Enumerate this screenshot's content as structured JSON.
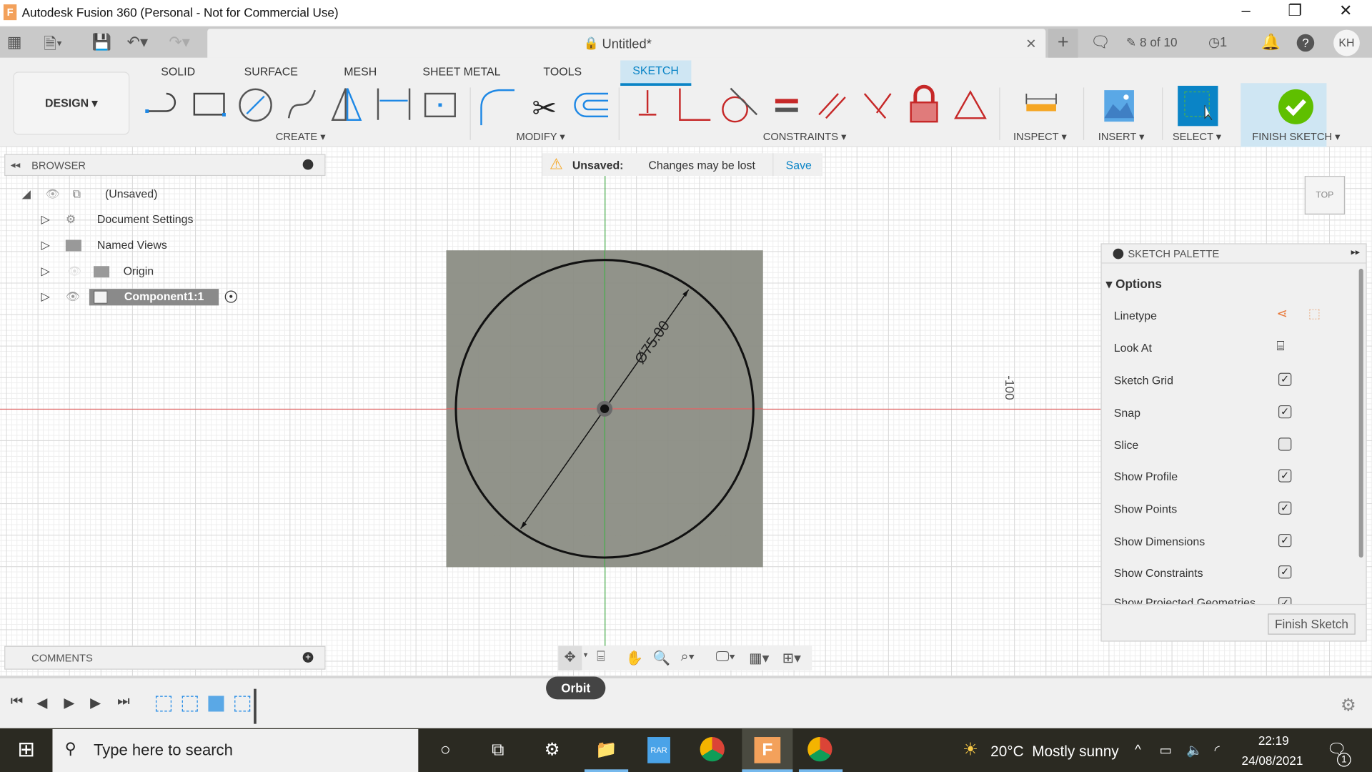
{
  "window": {
    "title": "Autodesk Fusion 360 (Personal - Not for Commercial Use)",
    "app_logo": "F",
    "minimize": "–",
    "restore": "❐",
    "close": "✕"
  },
  "quickbar": {
    "doc_title": "Untitled*",
    "close_tab": "✕",
    "new_tab": "+",
    "jobs": "8 of 10",
    "history_count": "1",
    "user_initials": "KH"
  },
  "ribbon": {
    "workspace": "DESIGN ▾",
    "tabs": [
      "SOLID",
      "SURFACE",
      "MESH",
      "SHEET METAL",
      "TOOLS",
      "SKETCH"
    ],
    "active_tab": "SKETCH",
    "groups": {
      "create": "CREATE ▾",
      "modify": "MODIFY ▾",
      "constraints": "CONSTRAINTS ▾",
      "inspect": "INSPECT ▾",
      "insert": "INSERT ▾",
      "select": "SELECT ▾",
      "finish": "FINISH SKETCH ▾"
    }
  },
  "browser": {
    "title": "BROWSER",
    "items": [
      {
        "label": "(Unsaved)"
      },
      {
        "label": "Document Settings"
      },
      {
        "label": "Named Views"
      },
      {
        "label": "Origin"
      },
      {
        "label": "Component1:1"
      }
    ]
  },
  "unsaved_bar": {
    "label": "Unsaved:",
    "message": "Changes may be lost",
    "save": "Save"
  },
  "viewcube": {
    "face": "TOP"
  },
  "sketch": {
    "dimension": "Ø75.00",
    "ruler_label": "-100"
  },
  "palette": {
    "title": "SKETCH PALETTE",
    "section": "Options",
    "rows": [
      {
        "label": "Linetype"
      },
      {
        "label": "Look At"
      },
      {
        "label": "Sketch Grid",
        "checked": true
      },
      {
        "label": "Snap",
        "checked": true
      },
      {
        "label": "Slice",
        "checked": false
      },
      {
        "label": "Show Profile",
        "checked": true
      },
      {
        "label": "Show Points",
        "checked": true
      },
      {
        "label": "Show Dimensions",
        "checked": true
      },
      {
        "label": "Show Constraints",
        "checked": true
      },
      {
        "label": "Show Projected Geometries",
        "checked": true
      }
    ],
    "finish": "Finish Sketch"
  },
  "comments": {
    "title": "COMMENTS"
  },
  "tooltip": "Orbit",
  "taskbar": {
    "search_placeholder": "Type here to search",
    "weather": "20°C  Mostly sunny",
    "time": "22:19",
    "date": "24/08/2021",
    "notif_count": "1"
  },
  "colors": {
    "accent": "#0a84c6",
    "sketch_plane": "#8b8d84",
    "x_axis": "#e06666",
    "y_axis": "#4caf50",
    "finish_green": "#5fbf00"
  }
}
